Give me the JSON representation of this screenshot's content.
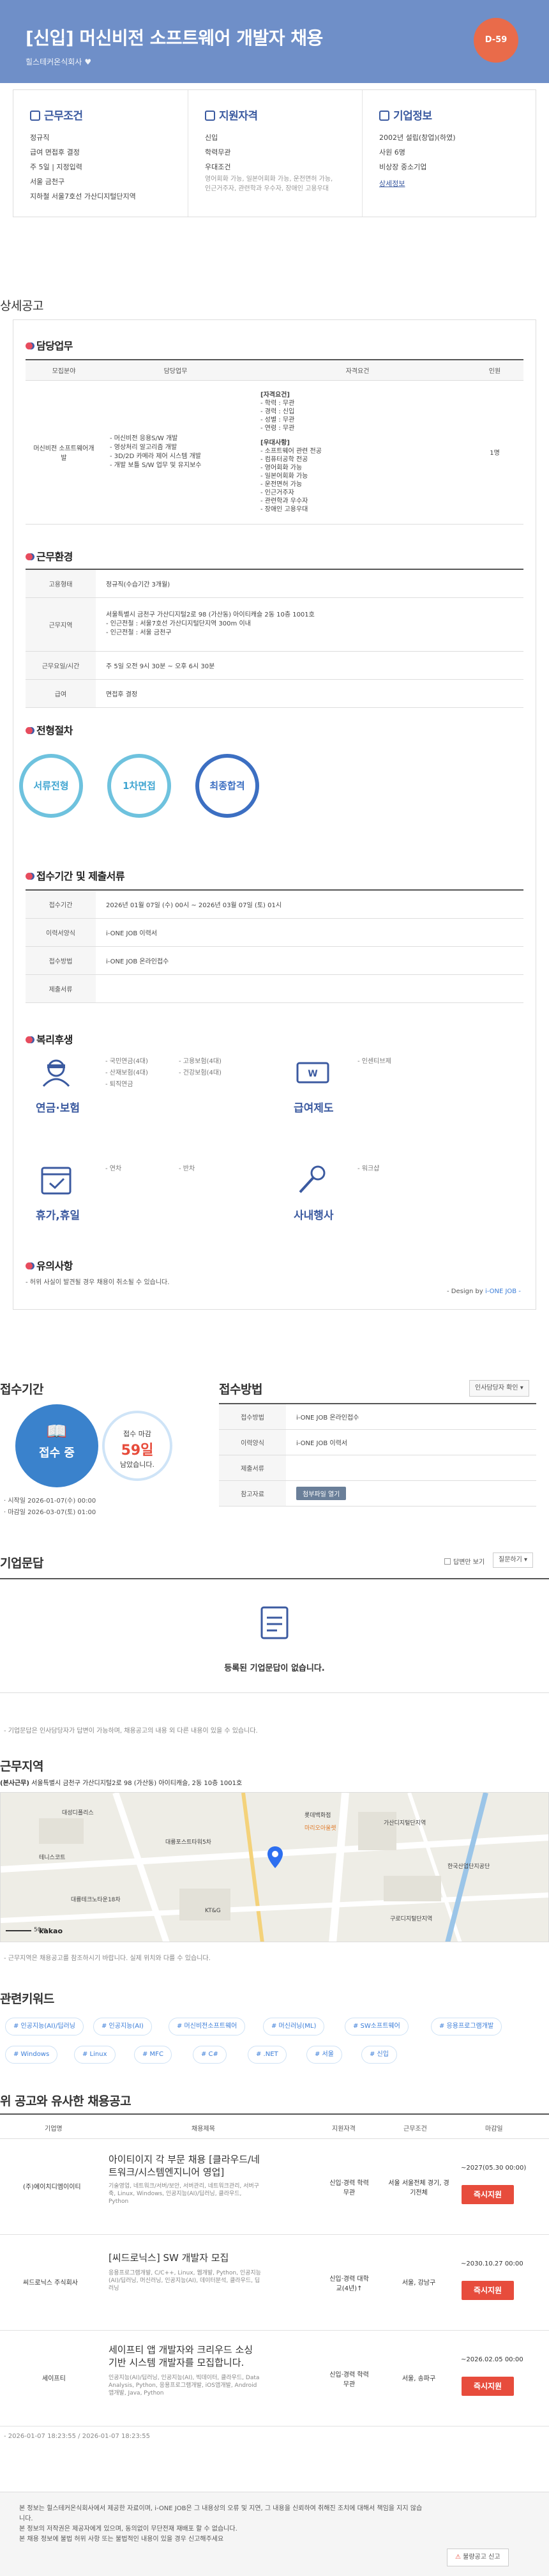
{
  "header": {
    "title": "[신입] 머신비전 소프트웨어 개발자 채용",
    "company": "힐스테커온식회사",
    "dday": "D-59"
  },
  "summary": {
    "conditions": {
      "title": "근무조건",
      "lines": [
        "정규직",
        "급여 면접후 결정",
        "주 5일 | 지정입력",
        "서울 금천구",
        "지하철 서울7호선 가산디지털단지역"
      ]
    },
    "qualifications": {
      "title": "지원자격",
      "lines": [
        "신입",
        "학력무관",
        "우대조건"
      ],
      "notes": "영어회화 가능, 일본어회화 가능, 운전면허 가능, 인근거주자, 관련학과 우수자, 장애인 고용우대"
    },
    "company": {
      "title": "기업정보",
      "lines": [
        "2002년 설립(창업)(하였)",
        "사원 6명",
        "비상장 중소기업"
      ],
      "link": "상세정보"
    }
  },
  "detail": {
    "section_title": "상세공고",
    "duties": {
      "title": "담당업무",
      "headers": [
        "모집분야",
        "담당업무",
        "자격요건",
        "인원"
      ],
      "field": "머신비전 소프트웨어개발",
      "tasks": [
        "- 머신비전 응용S/W 개발",
        "- 영상처리 알고리즘 개발",
        "- 3D/2D 카메라 제어 시스템 개발",
        "- 개발 보틀 S/W 업무 및 유지보수"
      ],
      "req_head": "[자격요건]",
      "reqs": [
        "- 학력 : 무관",
        "- 경력 : 신입",
        "- 성별 : 무관",
        "- 연령 : 무관"
      ],
      "pref_head": "[우대사항]",
      "prefs": [
        "- 소프트웨어 관련 전공",
        "- 컴퓨터공학 전공",
        "- 영어회화 가능",
        "- 일본어회화 가능",
        "- 운전면허 가능",
        "- 인근거주자",
        "- 관련학과 우수자",
        "- 장애인 고용우대"
      ],
      "count": "1명"
    },
    "environment": {
      "title": "근무환경",
      "rows": [
        {
          "label": "고용형태",
          "value": [
            "정규직(수습기간 3개월)"
          ]
        },
        {
          "label": "근무지역",
          "value": [
            "서울특별시 금천구 가산디지털2로 98 (가산동) 아이티캐슬 2동 10층 1001호",
            "- 인근전철 : 서울7호선 가산디지털단지역 300m 이내",
            "- 인근전철 : 서울 금천구"
          ]
        },
        {
          "label": "근무요일/시간",
          "value": [
            "주 5일 오전 9시 30분 ~ 오후 6시 30분"
          ]
        },
        {
          "label": "급여",
          "value": [
            "면접후 결정"
          ]
        }
      ]
    },
    "process": {
      "title": "전형절차",
      "steps": [
        "서류전형",
        "1차면접",
        "최종합격"
      ]
    },
    "application": {
      "title": "접수기간 및 제출서류",
      "rows": [
        {
          "label": "접수기간",
          "value": "2026년 01월 07일 (수) 00시 ~ 2026년 03월 07일 (토) 01시"
        },
        {
          "label": "이력서양식",
          "value": "i-ONE JOB 이력서"
        },
        {
          "label": "접수방법",
          "value": "i-ONE JOB 온라인접수"
        },
        {
          "label": "제출서류",
          "value": ""
        }
      ]
    },
    "benefits": {
      "title": "복리후생",
      "groups": [
        {
          "label": "연금·보험",
          "items": [
            "- 국민연금(4대)",
            "- 고용보험(4대)",
            "- 산재보험(4대)",
            "- 건강보험(4대)",
            "- 퇴직연금"
          ],
          "icon": "insurance-icon"
        },
        {
          "label": "급여제도",
          "items": [
            "- 인센티브제"
          ],
          "icon": "money-icon"
        },
        {
          "label": "휴가,휴일",
          "items": [
            "- 연차",
            "- 반차"
          ],
          "icon": "calendar-icon"
        },
        {
          "label": "사내행사",
          "items": [
            "- 워크샵"
          ],
          "icon": "microphone-icon"
        }
      ]
    },
    "notice": {
      "title": "유의사항",
      "text": "- 허위 사실이 발견될 경우 채용이 취소될 수 있습니다."
    },
    "design_by": "- Design by ",
    "design_by_link": "i-ONE JOB -"
  },
  "apply": {
    "period_title": "접수기간",
    "status": "접수 중",
    "deadline_label": "접수 마감",
    "deadline_days": "59일",
    "deadline_suffix": "남았습니다.",
    "start": "· 시작일 2026-01-07(수) 00:00",
    "end": "· 마감일 2026-03-07(토) 01:00",
    "method_title": "접수방법",
    "print_button": "인사담당자 확인",
    "rows": [
      {
        "label": "접수방법",
        "value": "i-ONE JOB 온라인접수"
      },
      {
        "label": "이력양식",
        "value": "i-ONE JOB 이력서"
      },
      {
        "label": "제출서류",
        "value": ""
      },
      {
        "label": "참고자료",
        "value": "첨부파일 열기"
      }
    ]
  },
  "qna": {
    "title": "기업문답",
    "check_label": "답변만 보기",
    "sort": "질문하기",
    "empty": "등록된 기업문답이 없습니다.",
    "note": "- 기업문답은 인사담당자가 답변이 가능하며, 채용공고의 내용 외 다른 내용이 있을 수 있습니다."
  },
  "location": {
    "title": "근무지역",
    "address_label": "(본사근무)",
    "address": "서울특별시 금천구 가산디지털2로 98 (가산동) 아이티캐슬, 2동 10층 1001호",
    "map_labels": [
      "대성디폴리스",
      "대륭포스트타워5차",
      "롯데백화점",
      "마리오아울렛",
      "가산디지털단지역",
      "테니스코트",
      "KT&G",
      "대륭테크노타운18차",
      "구로디지털단지역",
      "한국산업단지공단"
    ],
    "map_brand": "kakao",
    "scale": "50m",
    "note": "- 근무지역은 채용공고를 참조하시기 바랍니다. 실제 위치와 다를 수 있습니다."
  },
  "keywords": {
    "title": "관련키워드",
    "tags": [
      "# 인공지능(AI)/딥러닝",
      "# 인공지능(AI)",
      "# 머신비전소프트웨어",
      "# 머신러닝(ML)",
      "# SW소프트웨어",
      "# 응용프로그램개발",
      "# Windows",
      "# Linux",
      "# MFC",
      "# C#",
      "# .NET",
      "# 서울",
      "# 신입"
    ]
  },
  "related": {
    "title": "위 공고와 유사한 채용공고",
    "headers": [
      "기업명",
      "채용제목",
      "지원자격",
      "근무조건",
      "마감일"
    ],
    "apply_label": "즉시지원",
    "items": [
      {
        "company": "(주)에이치디엠이이티",
        "title": "아이티이지 각 부문 채용 [클라우드/네트워크/시스템엔지니어 영업]",
        "tags": "기술영업, 네트워크/서버/보안, 서버관리, 네트워크관리, 서버구축, Linux, Windows, 인공지능(AI)/딥러닝, 클라우드, Python",
        "qual": "신입·경력 학력무관",
        "cond": "서울 서울전체 경기, 경기전체",
        "deadline": "~2027(05.30 00:00)"
      },
      {
        "company": "씨드로닉스 주식회사",
        "title": "[씨드로닉스] SW 개발자 모집",
        "tags": "응용프로그램개발, C/C++, Linux, 웹개발, Python, 인공지능(AI)/딥러닝, 머신러닝, 인공지능(AI), 데이터분석, 클라우드, 딥러닝",
        "qual": "신입·경력 대학교(4년)↑",
        "cond": "서울, 강남구",
        "deadline": "~2030.10.27 00:00"
      },
      {
        "company": "세이프티",
        "title": "세이프티 앱 개발자와 크리우드 소싱 기반 시스템 개발자를 모집합니다.",
        "tags": "인공지능(AI)/딥러닝, 인공지능(AI), 빅데이터, 클라우드, Data Analysis, Python, 응용프로그램개발, iOS앱개발, Android앱개발, Java, Python",
        "qual": "신입·경력 학력무관",
        "cond": "서울, 송파구",
        "deadline": "~2026.02.05 00:00"
      }
    ]
  },
  "footer": {
    "date": "- 2026-01-07 18:23:55 / 2026-01-07 18:23:55",
    "lines": [
      "본 정보는 힐스테커온식회사에서 제공한 자료이며, i-ONE JOB은 그 내용상의 오류 및 지연, 그 내용을 신뢰하여 취해진 조치에 대해서 책임을 지지 않습니다.",
      "본 정보의 저작권은 제공자에게 있으며, 동의없이 무단전재 재배포 할 수 없습니다.",
      "본 채용 정보에 불법 허위 사항 또는 불법적인 내용이 있을 경우 신고해주세요"
    ],
    "report_button": "불량공고 신고"
  }
}
